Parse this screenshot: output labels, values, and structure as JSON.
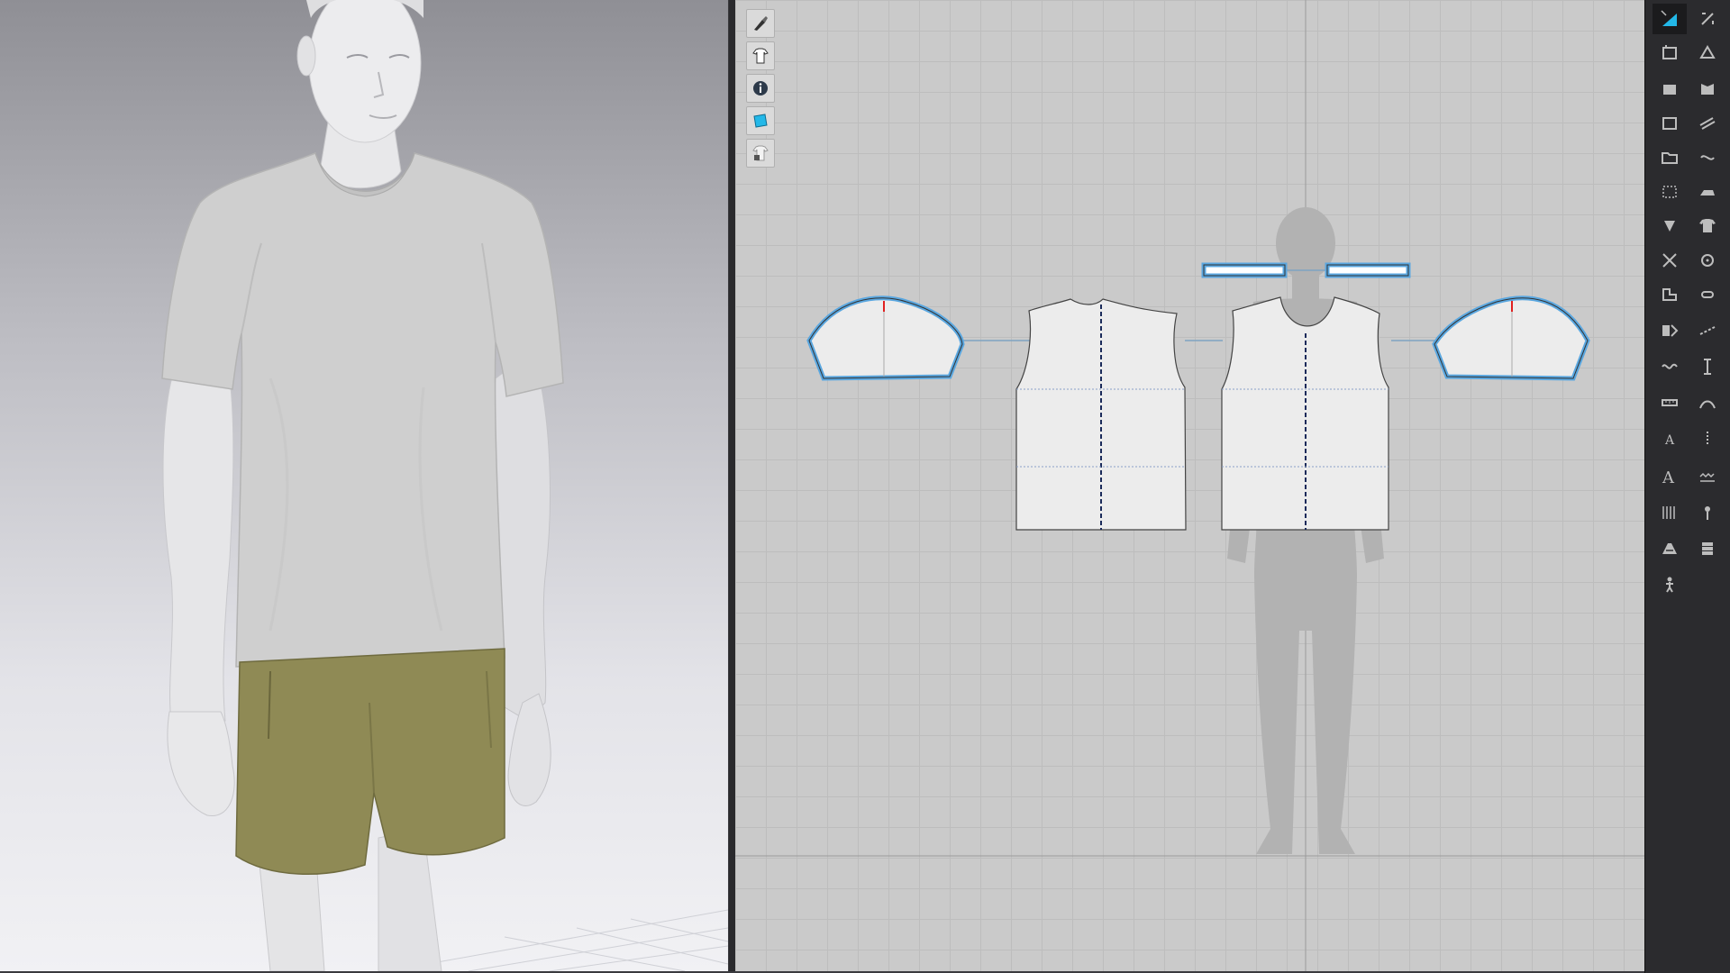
{
  "app": {
    "accent_color": "#5aa7e0",
    "active_tool_color": "#23b8e8"
  },
  "viewport3d": {
    "avatar": {
      "skin_color": "#e6e6e8",
      "shadow_color": "#b8b8bc"
    },
    "garments": [
      {
        "name": "t-shirt",
        "color": "#cfcfcf"
      },
      {
        "name": "shorts",
        "color": "#8f8a55"
      }
    ]
  },
  "window2d": {
    "pattern_pieces": [
      "sleeve-left",
      "back-bodice",
      "front-bodice",
      "sleeve-right",
      "neckband-left",
      "neckband-right"
    ],
    "fabric_color": "#ececec",
    "selected_outline_color": "#5aa7e0",
    "silhouette_color": "#b2b2b2"
  },
  "floating_toolbar": [
    {
      "icon": "brush-icon"
    },
    {
      "icon": "garment-visibility-icon"
    },
    {
      "icon": "info-icon"
    },
    {
      "icon": "texture-icon"
    },
    {
      "icon": "lock-garment-icon"
    }
  ],
  "right_toolbar": [
    {
      "icon": "select-pattern-icon",
      "active": true
    },
    {
      "icon": "edit-pattern-icon"
    },
    {
      "icon": "transform-icon"
    },
    {
      "icon": "add-point-icon"
    },
    {
      "icon": "polygon-icon"
    },
    {
      "icon": "internal-shape-icon"
    },
    {
      "icon": "rectangle-icon"
    },
    {
      "icon": "segment-sewing-icon"
    },
    {
      "icon": "folder-icon"
    },
    {
      "icon": "free-sewing-icon"
    },
    {
      "icon": "grid-select-icon"
    },
    {
      "icon": "iron-icon"
    },
    {
      "icon": "dart-icon"
    },
    {
      "icon": "shirt-icon"
    },
    {
      "icon": "cut-icon"
    },
    {
      "icon": "button-icon"
    },
    {
      "icon": "notch-icon"
    },
    {
      "icon": "buttonhole-icon"
    },
    {
      "icon": "unfold-icon"
    },
    {
      "icon": "topstitch-icon"
    },
    {
      "icon": "elastic-icon"
    },
    {
      "icon": "measure-line-icon"
    },
    {
      "icon": "ruler-icon"
    },
    {
      "icon": "curve-measure-icon"
    },
    {
      "icon": "text-add-icon"
    },
    {
      "icon": "zipper-icon"
    },
    {
      "icon": "text-icon"
    },
    {
      "icon": "stitch-icon"
    },
    {
      "icon": "grading-icon"
    },
    {
      "icon": "pin-icon"
    },
    {
      "icon": "fabric-grain-icon"
    },
    {
      "icon": "layer-icon"
    },
    {
      "icon": "avatar-pose-icon"
    }
  ]
}
